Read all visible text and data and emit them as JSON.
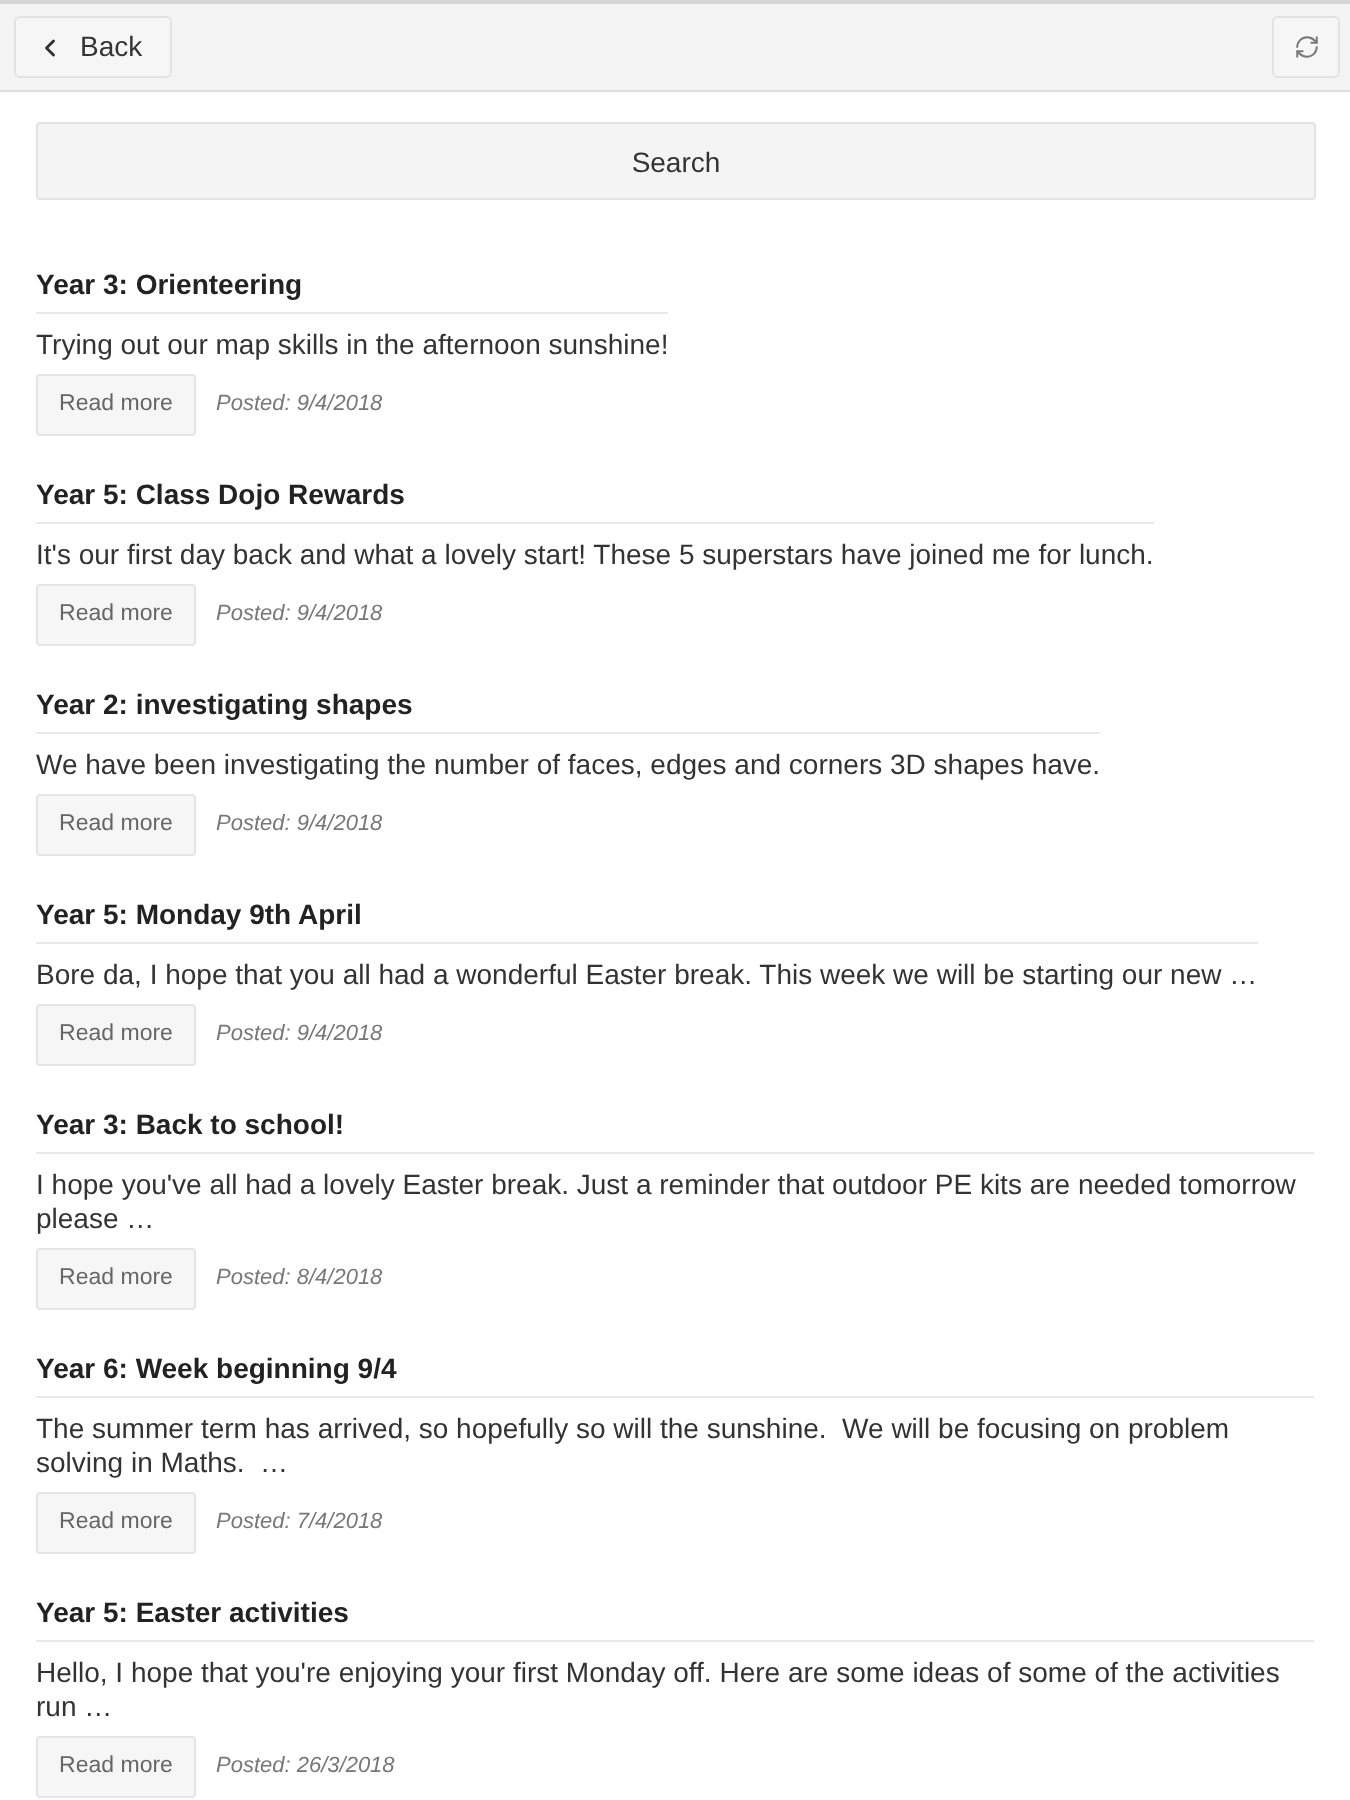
{
  "header": {
    "back_button": "Back"
  },
  "search": {
    "placeholder": "Search"
  },
  "posts": [
    {
      "title": "Year 3: Orienteering",
      "excerpt": "Trying out our map skills in the afternoon sunshine!",
      "button": "Read more",
      "posted": "Posted: 9/4/2018"
    },
    {
      "title": "Year 5: Class Dojo Rewards",
      "excerpt": "It's our first day back and what a lovely start! These 5 superstars have joined me for lunch.",
      "button": "Read more",
      "posted": "Posted: 9/4/2018"
    },
    {
      "title": "Year 2: investigating shapes",
      "excerpt": "We have been investigating the number of faces, edges and corners 3D shapes have.",
      "button": "Read more",
      "posted": "Posted: 9/4/2018"
    },
    {
      "title": "Year 5: Monday 9th April",
      "excerpt": "Bore da, I hope that you all had a wonderful Easter break. This week we will be starting our new …",
      "button": "Read more",
      "posted": "Posted: 9/4/2018"
    },
    {
      "title": "Year 3: Back to school!",
      "excerpt": "I hope you've all had a lovely Easter break. Just a reminder that outdoor PE kits are needed tomorrow please …",
      "button": "Read more",
      "posted": "Posted: 8/4/2018"
    },
    {
      "title": "Year 6: Week beginning 9/4",
      "excerpt": "The summer term has arrived, so hopefully so will the sunshine.  We will be focusing on problem solving in Maths.  …",
      "button": "Read more",
      "posted": "Posted: 7/4/2018"
    },
    {
      "title": "Year 5: Easter activities",
      "excerpt": "Hello, I hope that you're enjoying your first Monday off. Here are some ideas of some of the activities run …",
      "button": "Read more",
      "posted": "Posted: 26/3/2018"
    }
  ]
}
